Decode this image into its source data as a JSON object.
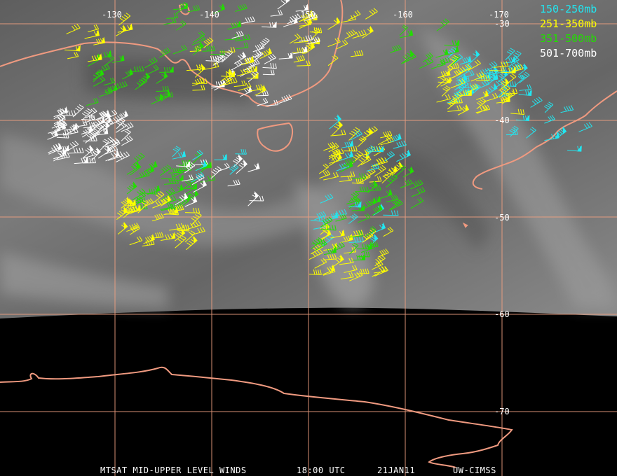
{
  "lon_labels": [
    "-130",
    "-140",
    "-150",
    "-160",
    "-170"
  ],
  "lat_labels": [
    "-30",
    "-40",
    "-50",
    "-60",
    "-70"
  ],
  "legend": [
    {
      "label": "150-250mb",
      "color": "#22e6f0"
    },
    {
      "label": "251-350mb",
      "color": "#ffff00"
    },
    {
      "label": "351-500mb",
      "color": "#22dd00"
    },
    {
      "label": "501-700mb",
      "color": "#ffffff"
    }
  ],
  "footer": {
    "product": "MTSAT MID-UPPER LEVEL WINDS",
    "time": "18:00 UTC",
    "date": "21JAN11",
    "source": "UW-CIMSS"
  },
  "colors": {
    "grid": "#f0a080",
    "coast": "#f09a80",
    "background": "#000000",
    "imagery": "#6e6e6e"
  },
  "wind_clusters": [
    {
      "layer": 3,
      "lon": -127,
      "lat": -42,
      "n": 70
    },
    {
      "layer": 2,
      "lon": -131,
      "lat": -36,
      "n": 26
    },
    {
      "layer": 1,
      "lon": -128,
      "lat": -32,
      "n": 10
    },
    {
      "layer": 2,
      "lon": -135,
      "lat": -47,
      "n": 40
    },
    {
      "layer": 1,
      "lon": -134,
      "lat": -51,
      "n": 36
    },
    {
      "layer": 3,
      "lon": -140,
      "lat": -47,
      "n": 16
    },
    {
      "layer": 0,
      "lon": -139,
      "lat": -44,
      "n": 8
    },
    {
      "layer": 3,
      "lon": -143,
      "lat": -36,
      "n": 26
    },
    {
      "layer": 1,
      "lon": -141,
      "lat": -35,
      "n": 22
    },
    {
      "layer": 2,
      "lon": -139,
      "lat": -31,
      "n": 18
    },
    {
      "layer": 1,
      "lon": -152,
      "lat": -32,
      "n": 26
    },
    {
      "layer": 3,
      "lon": -146,
      "lat": -31,
      "n": 14
    },
    {
      "layer": 1,
      "lon": -155,
      "lat": -44,
      "n": 38
    },
    {
      "layer": 0,
      "lon": -156,
      "lat": -43,
      "n": 12
    },
    {
      "layer": 2,
      "lon": -157,
      "lat": -47,
      "n": 24
    },
    {
      "layer": 0,
      "lon": -154,
      "lat": -51,
      "n": 14
    },
    {
      "layer": 1,
      "lon": -154,
      "lat": -54,
      "n": 30
    },
    {
      "layer": 2,
      "lon": -154,
      "lat": -52,
      "n": 18
    },
    {
      "layer": 0,
      "lon": -168,
      "lat": -36,
      "n": 46
    },
    {
      "layer": 1,
      "lon": -167,
      "lat": -37,
      "n": 40
    },
    {
      "layer": 2,
      "lon": -162,
      "lat": -33,
      "n": 14
    },
    {
      "layer": 0,
      "lon": -174,
      "lat": -41,
      "n": 12
    }
  ]
}
